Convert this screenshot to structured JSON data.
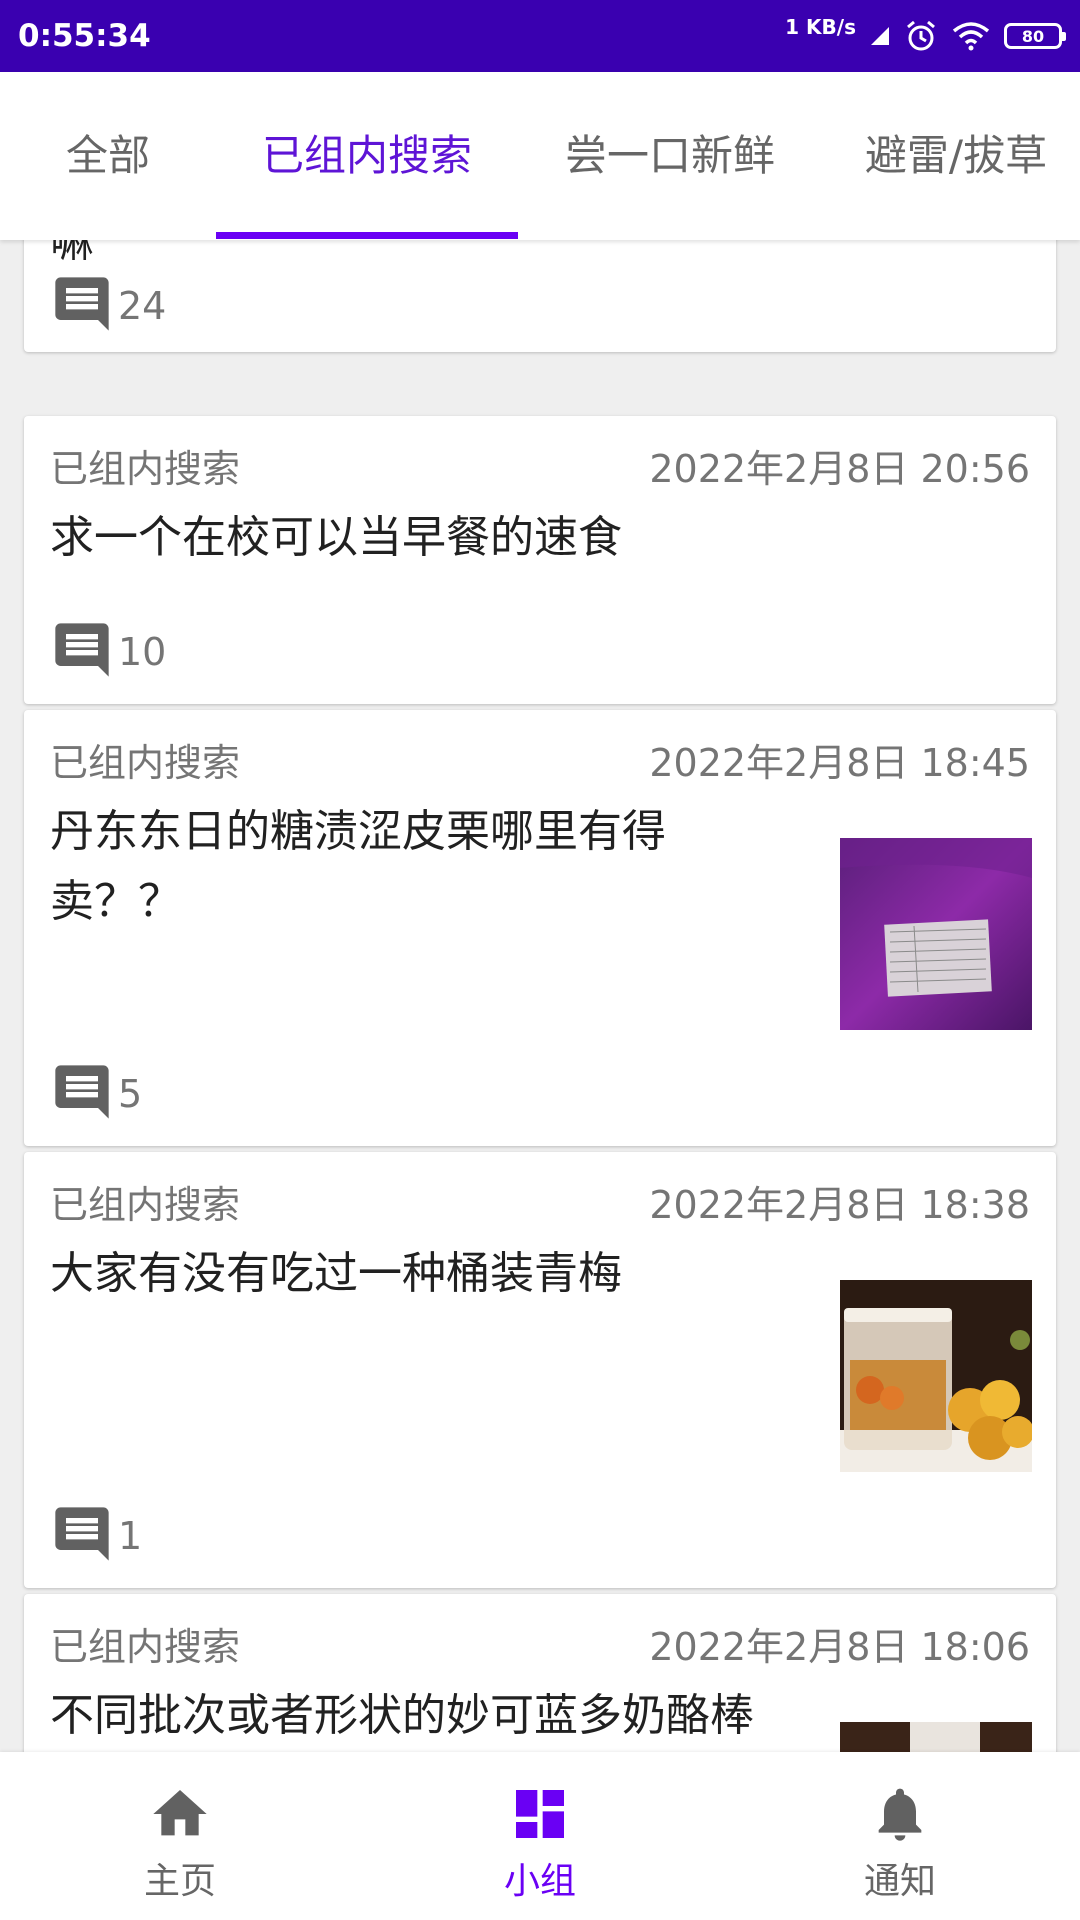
{
  "status_bar": {
    "time": "0:55:34",
    "net_speed": "1 KB/s",
    "battery": "80"
  },
  "tabs": [
    {
      "label": "全部"
    },
    {
      "label": "已组内搜索",
      "active": true
    },
    {
      "label": "尝一口新鲜"
    },
    {
      "label": "避雷/拔草"
    }
  ],
  "posts": [
    {
      "title_tail": "嘛",
      "comments": "24"
    },
    {
      "group": "已组内搜索",
      "date": "2022年2月8日 20:56",
      "title": "求一个在校可以当早餐的速食",
      "comments": "10"
    },
    {
      "group": "已组内搜索",
      "date": "2022年2月8日 18:45",
      "title_line1": "丹东东日的糖渍涩皮栗哪里有得",
      "title_line2": "卖？？",
      "comments": "5",
      "thumbnail": "chestnut-package-photo"
    },
    {
      "group": "已组内搜索",
      "date": "2022年2月8日 18:38",
      "title": "大家有没有吃过一种桶装青梅",
      "comments": "1",
      "thumbnail": "green-plum-bucket-photo"
    },
    {
      "group": "已组内搜索",
      "date": "2022年2月8日 18:06",
      "title": "不同批次或者形状的妙可蓝多奶酪棒"
    }
  ],
  "bottom_nav": [
    {
      "label": "主页",
      "icon": "home-icon"
    },
    {
      "label": "小组",
      "icon": "dashboard-icon",
      "active": true
    },
    {
      "label": "通知",
      "icon": "bell-icon"
    }
  ],
  "colors": {
    "status_bar": "#3a00b0",
    "accent": "#6a00f4",
    "secondary_text": "#757575"
  }
}
